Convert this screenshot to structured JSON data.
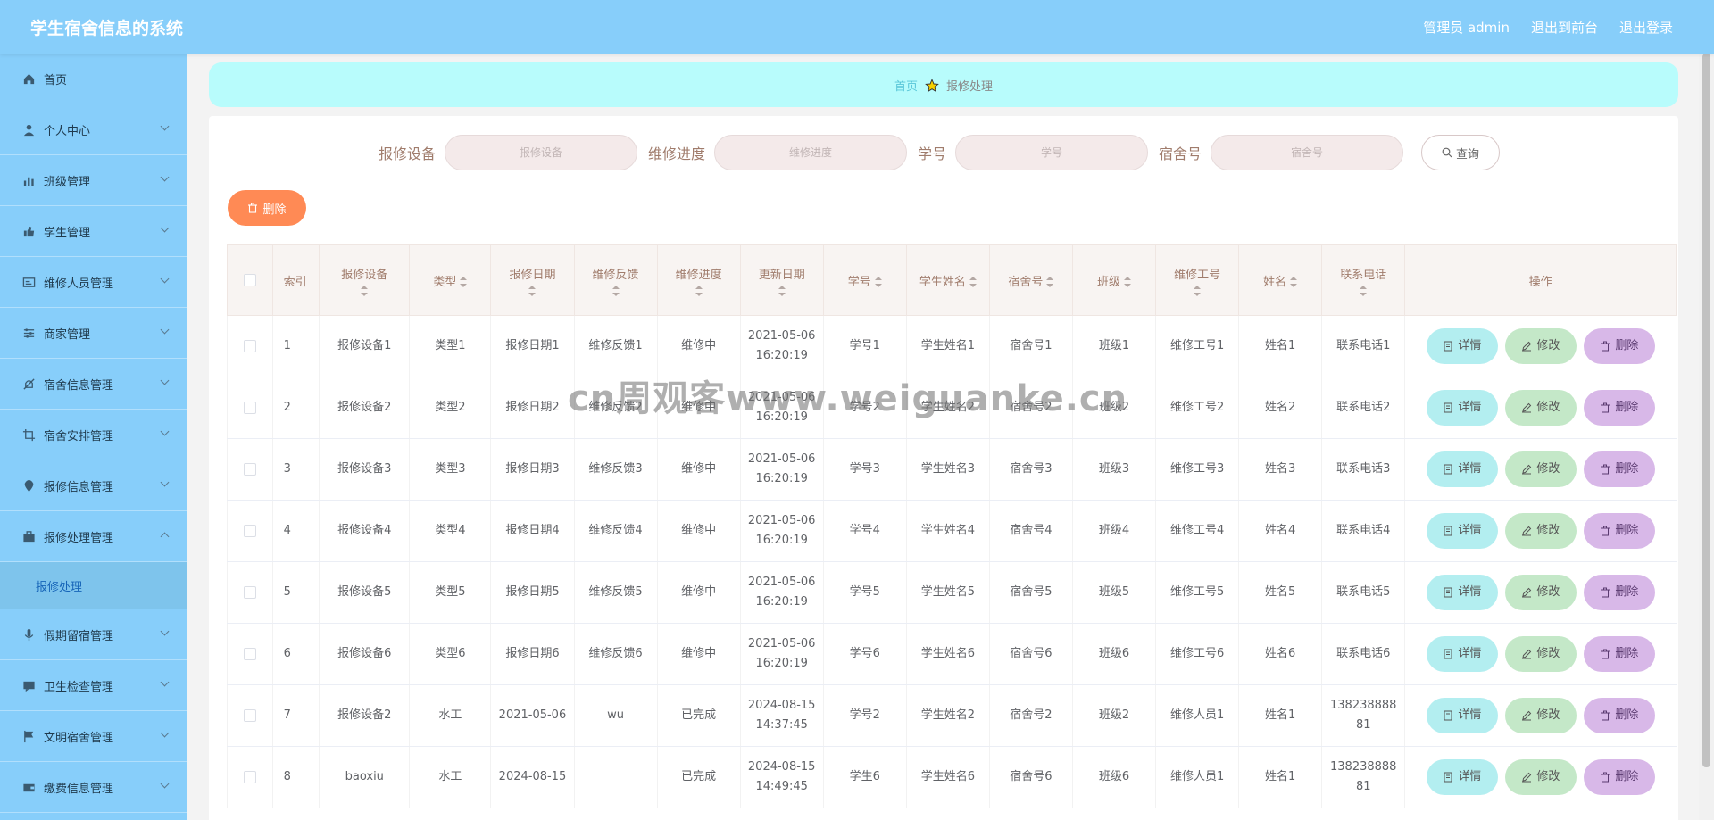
{
  "header": {
    "title": "学生宿舍信息的系统",
    "user": "管理员 admin",
    "front_link": "退出到前台",
    "logout_link": "退出登录"
  },
  "sidebar": {
    "items": [
      {
        "label": "首页",
        "icon": "home-icon",
        "arrow": ""
      },
      {
        "label": "个人中心",
        "icon": "user-icon",
        "arrow": "down"
      },
      {
        "label": "班级管理",
        "icon": "bar-chart-icon",
        "arrow": "down"
      },
      {
        "label": "学生管理",
        "icon": "thumb-icon",
        "arrow": "down"
      },
      {
        "label": "维修人员管理",
        "icon": "id-card-icon",
        "arrow": "down"
      },
      {
        "label": "商家管理",
        "icon": "sliders-icon",
        "arrow": "down"
      },
      {
        "label": "宿舍信息管理",
        "icon": "no-bell-icon",
        "arrow": "down"
      },
      {
        "label": "宿舍安排管理",
        "icon": "crop-icon",
        "arrow": "down"
      },
      {
        "label": "报修信息管理",
        "icon": "location-icon",
        "arrow": "down"
      },
      {
        "label": "报修处理管理",
        "icon": "briefcase-icon",
        "arrow": "up"
      }
    ],
    "sub_item": "报修处理",
    "items_after": [
      {
        "label": "假期留宿管理",
        "icon": "microphone-icon",
        "arrow": "down"
      },
      {
        "label": "卫生检查管理",
        "icon": "chat-icon",
        "arrow": "down"
      },
      {
        "label": "文明宿舍管理",
        "icon": "flag-icon",
        "arrow": "down"
      },
      {
        "label": "缴费信息管理",
        "icon": "wallet-icon",
        "arrow": "down"
      }
    ]
  },
  "breadcrumb": {
    "home": "首页",
    "current": "报修处理"
  },
  "search": {
    "device_label": "报修设备",
    "device_placeholder": "报修设备",
    "progress_label": "维修进度",
    "progress_placeholder": "维修进度",
    "student_no_label": "学号",
    "student_no_placeholder": "学号",
    "dorm_label": "宿舍号",
    "dorm_placeholder": "宿舍号",
    "query_label": "查询"
  },
  "toolbar": {
    "delete_label": "删除"
  },
  "table": {
    "columns": [
      "索引",
      "报修设备",
      "类型",
      "报修日期",
      "维修反馈",
      "维修进度",
      "更新日期",
      "学号",
      "学生姓名",
      "宿舍号",
      "班级",
      "维修工号",
      "姓名",
      "联系电话",
      "操作"
    ],
    "actions": {
      "detail": "详情",
      "edit": "修改",
      "remove": "删除"
    },
    "rows": [
      [
        "1",
        "报修设备1",
        "类型1",
        "报修日期1",
        "维修反馈1",
        "维修中",
        "2021-05-06 16:20:19",
        "学号1",
        "学生姓名1",
        "宿舍号1",
        "班级1",
        "维修工号1",
        "姓名1",
        "联系电话1"
      ],
      [
        "2",
        "报修设备2",
        "类型2",
        "报修日期2",
        "维修反馈2",
        "维修中",
        "2021-05-06 16:20:19",
        "学号2",
        "学生姓名2",
        "宿舍号2",
        "班级2",
        "维修工号2",
        "姓名2",
        "联系电话2"
      ],
      [
        "3",
        "报修设备3",
        "类型3",
        "报修日期3",
        "维修反馈3",
        "维修中",
        "2021-05-06 16:20:19",
        "学号3",
        "学生姓名3",
        "宿舍号3",
        "班级3",
        "维修工号3",
        "姓名3",
        "联系电话3"
      ],
      [
        "4",
        "报修设备4",
        "类型4",
        "报修日期4",
        "维修反馈4",
        "维修中",
        "2021-05-06 16:20:19",
        "学号4",
        "学生姓名4",
        "宿舍号4",
        "班级4",
        "维修工号4",
        "姓名4",
        "联系电话4"
      ],
      [
        "5",
        "报修设备5",
        "类型5",
        "报修日期5",
        "维修反馈5",
        "维修中",
        "2021-05-06 16:20:19",
        "学号5",
        "学生姓名5",
        "宿舍号5",
        "班级5",
        "维修工号5",
        "姓名5",
        "联系电话5"
      ],
      [
        "6",
        "报修设备6",
        "类型6",
        "报修日期6",
        "维修反馈6",
        "维修中",
        "2021-05-06 16:20:19",
        "学号6",
        "学生姓名6",
        "宿舍号6",
        "班级6",
        "维修工号6",
        "姓名6",
        "联系电话6"
      ],
      [
        "7",
        "报修设备2",
        "水工",
        "2021-05-06",
        "wu",
        "已完成",
        "2024-08-15 14:37:45",
        "学号2",
        "学生姓名2",
        "宿舍号2",
        "班级2",
        "维修人员1",
        "姓名1",
        "13823888881"
      ],
      [
        "8",
        "baoxiu",
        "水工",
        "2024-08-15",
        "",
        "已完成",
        "2024-08-15 14:49:45",
        "学生6",
        "学生姓名6",
        "宿舍号6",
        "班级6",
        "维修人员1",
        "姓名1",
        "13823888881"
      ]
    ]
  },
  "watermark": "cn周观客www.weiguanke.cn",
  "colors": {
    "header_bg": "#87cefa",
    "breadcrumb_bg": "#b8fcfc",
    "delete_button": "#ff8a55",
    "detail_button": "#b3eef0",
    "edit_button": "#c4e8c8",
    "remove_button": "#d8b8e8"
  }
}
